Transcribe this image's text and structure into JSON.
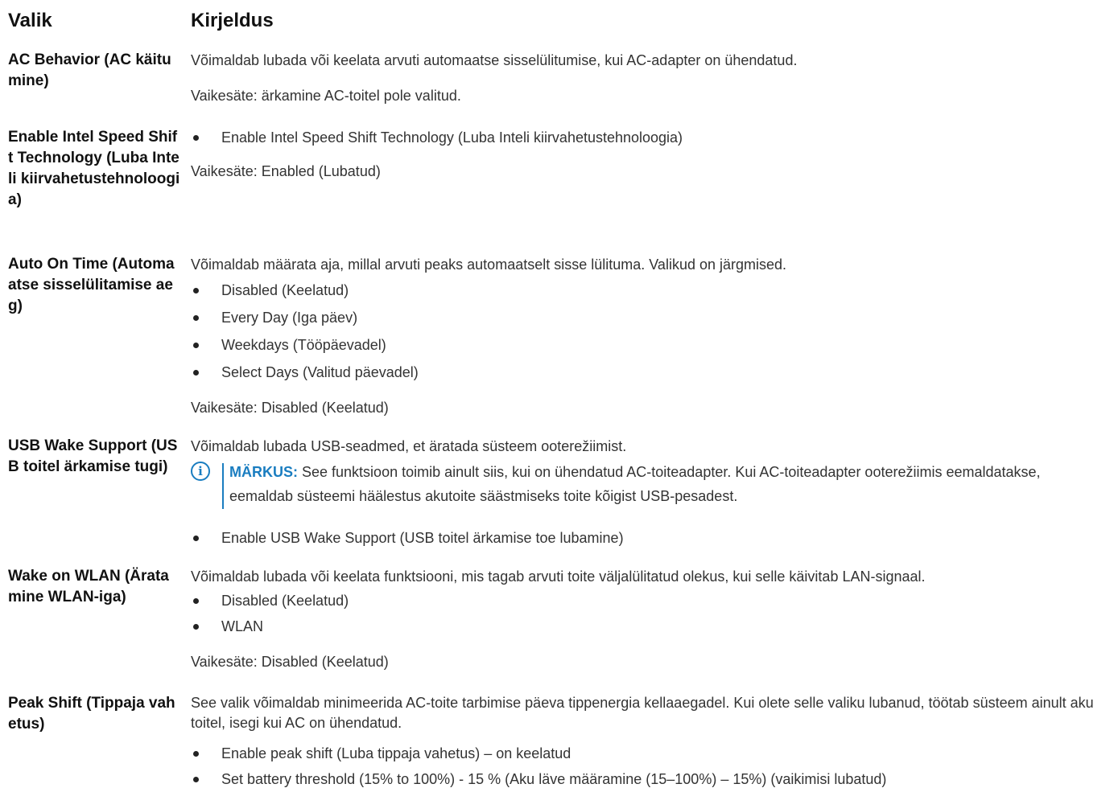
{
  "header": {
    "option": "Valik",
    "description": "Kirjeldus"
  },
  "rows": {
    "ac": {
      "name": "AC Behavior (AC käitumine)",
      "p1": "Võimaldab lubada või keelata arvuti automaatse sisselülitumise, kui AC-adapter on ühendatud.",
      "default": "Vaikesäte: ärkamine AC-toitel pole valitud."
    },
    "speedshift": {
      "name": "Enable Intel Speed Shift Technology (Luba Inteli kiirvahetustehnoloogia)",
      "b1": "Enable Intel Speed Shift Technology (Luba Inteli kiirvahetustehnoloogia)",
      "default": "Vaikesäte: Enabled (Lubatud)"
    },
    "autoon": {
      "name": "Auto On Time (Automaatse sisselülitamise aeg)",
      "p1": "Võimaldab määrata aja, millal arvuti peaks automaatselt sisse lülituma. Valikud on järgmised.",
      "b1": "Disabled (Keelatud)",
      "b2": "Every Day (Iga päev)",
      "b3": "Weekdays (Tööpäevadel)",
      "b4": "Select Days (Valitud päevadel)",
      "default": "Vaikesäte: Disabled (Keelatud)"
    },
    "usbwake": {
      "name": "USB Wake Support (USB toitel ärkamise tugi)",
      "p1": "Võimaldab lubada USB-seadmed, et äratada süsteem ooterežiimist.",
      "note_label": "MÄRKUS:",
      "note_text": " See funktsioon toimib ainult siis, kui on ühendatud AC-toiteadapter. Kui AC-toiteadapter ooterežiimis eemaldatakse, eemaldab süsteemi häälestus akutoite säästmiseks toite kõigist USB-pesadest.",
      "b1": "Enable USB Wake Support (USB toitel ärkamise toe lubamine)"
    },
    "wlan": {
      "name": "Wake on WLAN (Äratamine WLAN-iga)",
      "p1": "Võimaldab lubada või keelata funktsiooni, mis tagab arvuti toite väljalülitatud olekus, kui selle käivitab LAN-signaal.",
      "b1": "Disabled (Keelatud)",
      "b2": "WLAN",
      "default": "Vaikesäte: Disabled (Keelatud)"
    },
    "peak": {
      "name": "Peak Shift (Tippaja vahetus)",
      "p1": "See valik võimaldab minimeerida AC-toite tarbimise päeva tippenergia kellaaegadel. Kui olete selle valiku lubanud, töötab süsteem ainult aku toitel, isegi kui AC on ühendatud.",
      "b1": "Enable peak shift (Luba tippaja vahetus) – on keelatud",
      "b2": "Set battery threshold (15% to 100%) - 15 % (Aku läve määramine (15–100%) – 15%) (vaikimisi lubatud)"
    }
  }
}
